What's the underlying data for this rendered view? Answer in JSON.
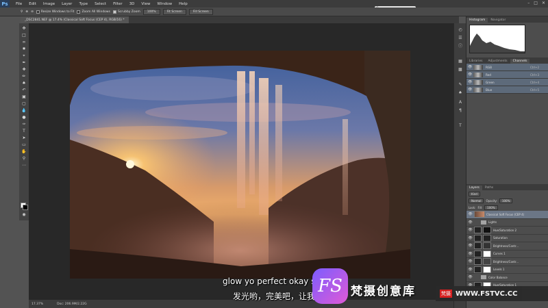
{
  "app": {
    "logo": "Ps",
    "menus": [
      "File",
      "Edit",
      "Image",
      "Layer",
      "Type",
      "Select",
      "Filter",
      "3D",
      "View",
      "Window",
      "Help"
    ],
    "search_placeholder": "Selective Text"
  },
  "options": {
    "resize_windows": "Resize Windows to Fit",
    "zoom_all": "Zoom All Windows",
    "scrubby_zoom": "Scrubby Zoom",
    "btn_100": "100%",
    "fit_screen": "Fit Screen",
    "fill_screen": "Fill Screen"
  },
  "document": {
    "tab_title": "_DSC2841.NEF @ 17.4% (Classical Soft Focus (CEP 4), RGB/16) *"
  },
  "status": {
    "zoom": "17.37%",
    "doc": "Doc: 206.9M/2.22G"
  },
  "panels": {
    "top_tabs": [
      "Histogram",
      "Navigator"
    ],
    "mid_tabs": [
      "Libraries",
      "Adjustments",
      "Channels"
    ],
    "channels": [
      {
        "name": "RGB",
        "key": "Ctrl+2"
      },
      {
        "name": "Red",
        "key": "Ctrl+3"
      },
      {
        "name": "Green",
        "key": "Ctrl+4"
      },
      {
        "name": "Blue",
        "key": "Ctrl+5"
      }
    ],
    "layers_tabs": [
      "Layers",
      "Paths"
    ],
    "kind_label": "Kind",
    "blend_mode": "Normal",
    "opacity_label": "Opacity:",
    "opacity_value": "100%",
    "lock_label": "Lock:",
    "fill_label": "Fill:",
    "fill_value": "100%",
    "layers": [
      {
        "name": "Classical Soft Focus (CEP 4)",
        "type": "smart",
        "selected": true
      },
      {
        "name": "Lights",
        "type": "folder",
        "selected": false
      },
      {
        "name": "Hue/Saturation 2",
        "type": "adj",
        "selected": false
      },
      {
        "name": "Saturation",
        "type": "adj",
        "selected": false
      },
      {
        "name": "Brightness/Contr...",
        "type": "adj",
        "selected": false
      },
      {
        "name": "Curves 1",
        "type": "adj",
        "selected": false
      },
      {
        "name": "Brightness/Contr...",
        "type": "adj",
        "selected": false
      },
      {
        "name": "Levels 1",
        "type": "adj",
        "selected": false
      },
      {
        "name": "Color Balance",
        "type": "folder",
        "selected": false
      },
      {
        "name": "Hue/Saturation 1",
        "type": "adj",
        "selected": false
      }
    ]
  },
  "subtitles": {
    "line1": "glow yo perfect okay so l",
    "line2": "发光哟，完美吧，让我"
  },
  "watermark": {
    "logo": "FS",
    "text": "梵摄创意库",
    "site_badge": "梵摄",
    "url": "WWW.FSTVC.CC"
  }
}
